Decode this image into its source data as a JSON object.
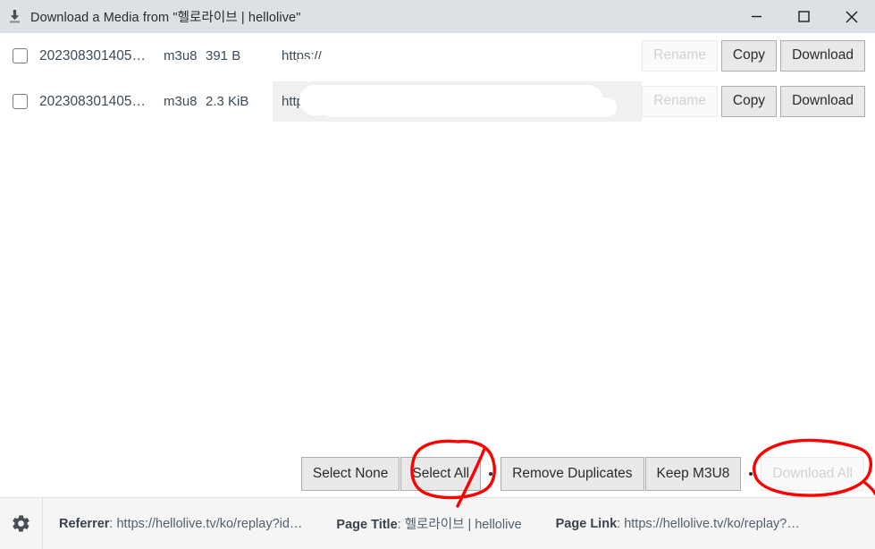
{
  "window": {
    "title": "Download a Media from \"헬로라이브 | hellolive\"",
    "icon": "download-icon",
    "controls": {
      "minimize": "minimize-icon",
      "maximize": "maximize-icon",
      "close": "close-icon"
    }
  },
  "colors": {
    "titlebar_bg": "#dde1e6",
    "button_bg": "#e9e9e9",
    "button_border": "#adadad",
    "text": "#3c4a5a",
    "annotation_red": "#ff0000",
    "statusbar_bg": "#f5f5f5",
    "row_highlight": "#f0f0f0"
  },
  "file_list": {
    "rows": [
      {
        "checked": false,
        "name": "202308301405…",
        "type": "m3u8",
        "size": "391 B",
        "url": "https://",
        "highlight": false,
        "actions": [
          {
            "label": "Rename",
            "disabled": true
          },
          {
            "label": "Copy",
            "disabled": false
          },
          {
            "label": "Download",
            "disabled": false
          }
        ]
      },
      {
        "checked": false,
        "name": "202308301405…",
        "type": "m3u8",
        "size": "2.3 KiB",
        "url": "https://",
        "highlight": true,
        "actions": [
          {
            "label": "Rename",
            "disabled": true
          },
          {
            "label": "Copy",
            "disabled": false
          },
          {
            "label": "Download",
            "disabled": false
          }
        ]
      }
    ]
  },
  "toolbar": {
    "select_none": "Select None",
    "select_all": "Select All",
    "remove_duplicates": "Remove Duplicates",
    "keep_m3u8": "Keep M3U8",
    "download_all": "Download All",
    "download_all_disabled": true
  },
  "statusbar": {
    "gear": "gear-icon",
    "referrer_label": "Referrer",
    "referrer_value": ": https://hellolive.tv/ko/replay?id…",
    "page_title_label": "Page Title",
    "page_title_value": ": 헬로라이브 | hellolive",
    "page_link_label": "Page Link",
    "page_link_value": ": https://hellolive.tv/ko/replay?…"
  },
  "annotations": {
    "circle_select_all": "red-circle-around-select-all",
    "circle_download_all": "red-circle-around-download-all"
  }
}
